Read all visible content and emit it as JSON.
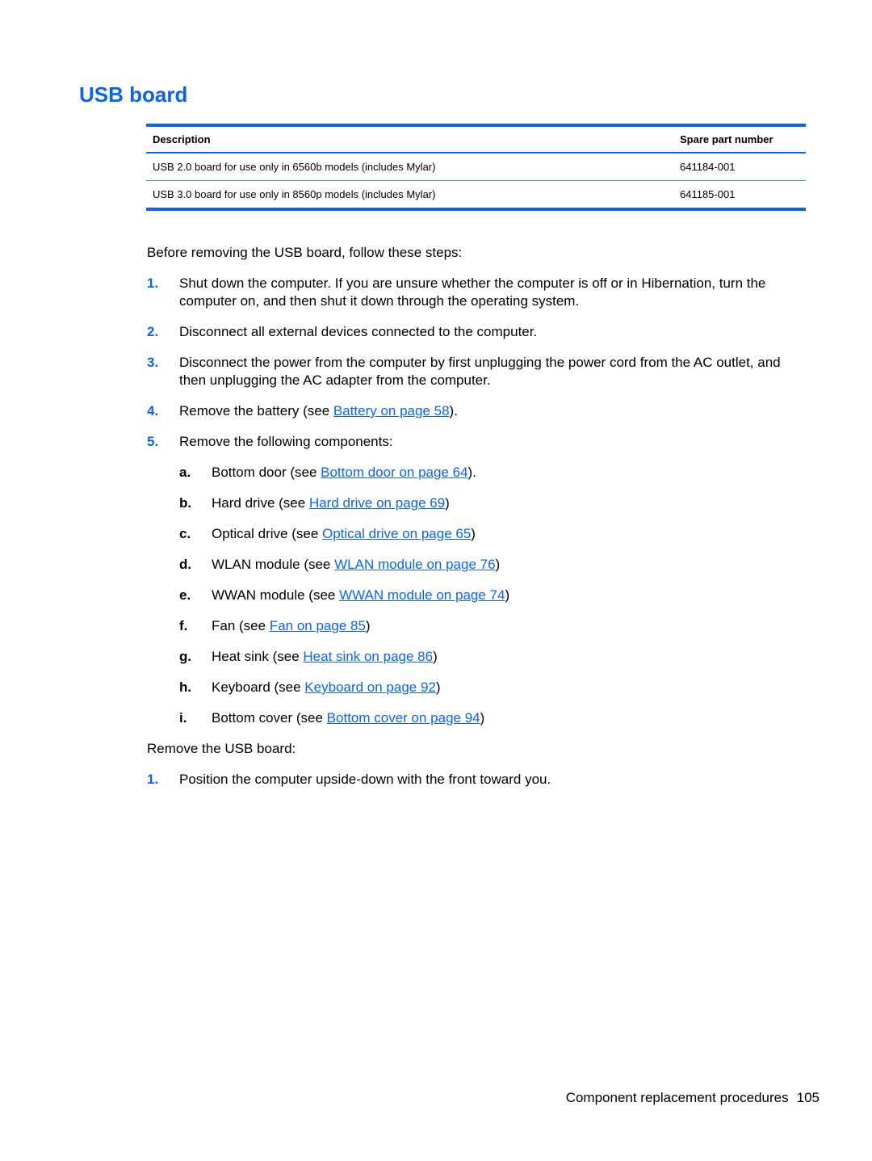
{
  "heading": "USB board",
  "colors": {
    "accent": "#0a64f0",
    "text": "#000000"
  },
  "table": {
    "headers": [
      "Description",
      "Spare part number"
    ],
    "rows": [
      [
        "USB 2.0 board for use only in 6560b models (includes Mylar)",
        "641184-001"
      ],
      [
        "USB 3.0 board for use only in 8560p models (includes Mylar)",
        "641185-001"
      ]
    ]
  },
  "intro": "Before removing the USB board, follow these steps:",
  "steps": [
    {
      "num": "1.",
      "text": "Shut down the computer. If you are unsure whether the computer is off or in Hibernation, turn the computer on, and then shut it down through the operating system."
    },
    {
      "num": "2.",
      "text": "Disconnect all external devices connected to the computer."
    },
    {
      "num": "3.",
      "text": "Disconnect the power from the computer by first unplugging the power cord from the AC outlet, and then unplugging the AC adapter from the computer."
    },
    {
      "num": "4.",
      "before": "Remove the battery (see ",
      "link": "Battery on page 58",
      "after": ")."
    },
    {
      "num": "5.",
      "text": "Remove the following components:"
    }
  ],
  "substeps": [
    {
      "letter": "a.",
      "before": "Bottom door (see ",
      "link": "Bottom door on page 64",
      "after": ")."
    },
    {
      "letter": "b.",
      "before": "Hard drive (see ",
      "link": "Hard drive on page 69",
      "after": ")"
    },
    {
      "letter": "c.",
      "before": "Optical drive (see ",
      "link": "Optical drive on page 65",
      "after": ")"
    },
    {
      "letter": "d.",
      "before": "WLAN module (see ",
      "link": "WLAN module on page 76",
      "after": ")"
    },
    {
      "letter": "e.",
      "before": "WWAN module (see ",
      "link": "WWAN module on page 74",
      "after": ")"
    },
    {
      "letter": "f.",
      "before": "Fan (see ",
      "link": "Fan on page 85",
      "after": ")"
    },
    {
      "letter": "g.",
      "before": "Heat sink (see ",
      "link": "Heat sink on page 86",
      "after": ")"
    },
    {
      "letter": "h.",
      "before": "Keyboard (see ",
      "link": "Keyboard on page 92",
      "after": ")"
    },
    {
      "letter": "i.",
      "before": "Bottom cover (see ",
      "link": "Bottom cover on page 94",
      "after": ")"
    }
  ],
  "remove_intro": "Remove the USB board:",
  "remove_steps": [
    {
      "num": "1.",
      "text": "Position the computer upside-down with the front toward you."
    }
  ],
  "footer": {
    "section": "Component replacement procedures",
    "page": "105"
  }
}
